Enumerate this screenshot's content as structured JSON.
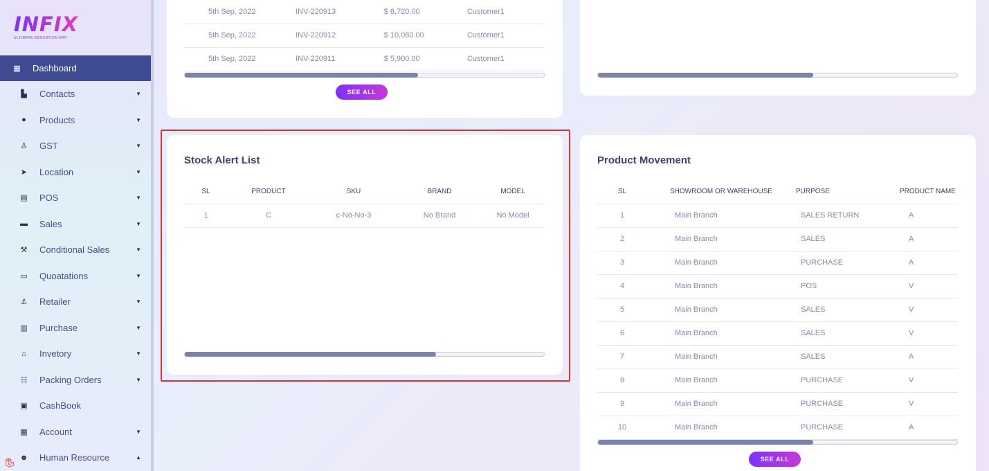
{
  "sidebar": {
    "logo_text": "INFIX",
    "logo_tagline": "ULTIMATE EDUCATION ERP",
    "items": [
      {
        "label": "Dashboard",
        "icon": "grid-icon",
        "glyph": "▦",
        "caret": ""
      },
      {
        "label": "Contacts",
        "icon": "contact-card-icon",
        "glyph": "▙",
        "caret": "▼"
      },
      {
        "label": "Products",
        "icon": "product-circle-icon",
        "glyph": "●",
        "caret": "▼"
      },
      {
        "label": "GST",
        "icon": "user-tie-icon",
        "glyph": "♙",
        "caret": "▼"
      },
      {
        "label": "Location",
        "icon": "location-arrow-icon",
        "glyph": "➤",
        "caret": "▼"
      },
      {
        "label": "POS",
        "icon": "cash-register-icon",
        "glyph": "▤",
        "caret": "▼"
      },
      {
        "label": "Sales",
        "icon": "inbox-icon",
        "glyph": "▬",
        "caret": "▼"
      },
      {
        "label": "Conditional Sales",
        "icon": "gavel-icon",
        "glyph": "⚒",
        "caret": "▼"
      },
      {
        "label": "Quoatations",
        "icon": "laptop-icon",
        "glyph": "▭",
        "caret": "▼"
      },
      {
        "label": "Retailer",
        "icon": "anchor-icon",
        "glyph": "⚓",
        "caret": "▼"
      },
      {
        "label": "Purchase",
        "icon": "store-icon",
        "glyph": "▥",
        "caret": "▼"
      },
      {
        "label": "Invetory",
        "icon": "landmark-icon",
        "glyph": "⌂",
        "caret": "▼"
      },
      {
        "label": "Packing Orders",
        "icon": "users-icon",
        "glyph": "☷",
        "caret": "▼"
      },
      {
        "label": "CashBook",
        "icon": "book-icon",
        "glyph": "▣",
        "caret": ""
      },
      {
        "label": "Account",
        "icon": "calculator-icon",
        "glyph": "▦",
        "caret": "▼"
      },
      {
        "label": "Human Resource",
        "icon": "user-group-icon",
        "glyph": "☻",
        "caret": "▲"
      }
    ]
  },
  "invoice_card": {
    "rows": [
      {
        "date": "5th Sep, 2022",
        "invoice": "INV-220913",
        "amount": "$ 6,720.00",
        "customer": "Customer1"
      },
      {
        "date": "5th Sep, 2022",
        "invoice": "INV-220912",
        "amount": "$ 10,080.00",
        "customer": "Customer1"
      },
      {
        "date": "5th Sep, 2022",
        "invoice": "INV-220911",
        "amount": "$ 5,900.00",
        "customer": "Customer1"
      }
    ],
    "scroll_fraction": 0.65,
    "see_all": "SEE ALL"
  },
  "top_right_card": {
    "scroll_fraction": 0.6
  },
  "stock_alert": {
    "title": "Stock Alert List",
    "headers": [
      "SL",
      "PRODUCT",
      "SKU",
      "BRAND",
      "MODEL"
    ],
    "rows": [
      {
        "sl": "1",
        "product": "C",
        "sku": "c-No-No-3",
        "brand": "No Brand",
        "model": "No Model"
      }
    ],
    "scroll_fraction": 0.7
  },
  "product_movement": {
    "title": "Product Movement",
    "headers": [
      "SL",
      "SHOWROOM OR WAREHOUSE",
      "PURPOSE",
      "PRODUCT NAME"
    ],
    "rows": [
      {
        "sl": "1",
        "showroom": "Main Branch",
        "purpose": "SALES RETURN",
        "product": "A"
      },
      {
        "sl": "2",
        "showroom": "Main Branch",
        "purpose": "SALES",
        "product": "A"
      },
      {
        "sl": "3",
        "showroom": "Main Branch",
        "purpose": "PURCHASE",
        "product": "A"
      },
      {
        "sl": "4",
        "showroom": "Main Branch",
        "purpose": "POS",
        "product": "V"
      },
      {
        "sl": "5",
        "showroom": "Main Branch",
        "purpose": "SALES",
        "product": "V"
      },
      {
        "sl": "6",
        "showroom": "Main Branch",
        "purpose": "SALES",
        "product": "V"
      },
      {
        "sl": "7",
        "showroom": "Main Branch",
        "purpose": "SALES",
        "product": "A"
      },
      {
        "sl": "8",
        "showroom": "Main Branch",
        "purpose": "PURCHASE",
        "product": "V"
      },
      {
        "sl": "9",
        "showroom": "Main Branch",
        "purpose": "PURCHASE",
        "product": "V"
      },
      {
        "sl": "10",
        "showroom": "Main Branch",
        "purpose": "PURCHASE",
        "product": "A"
      }
    ],
    "scroll_fraction": 0.6,
    "see_all": "SEE ALL"
  },
  "colors": {
    "accent_purple": "#7c32ff",
    "accent_pink": "#c738d8",
    "sidebar_active": "#3f4b92",
    "highlight_red": "#e03131",
    "text_dark": "#3c4276",
    "text_muted": "#828bb2"
  }
}
